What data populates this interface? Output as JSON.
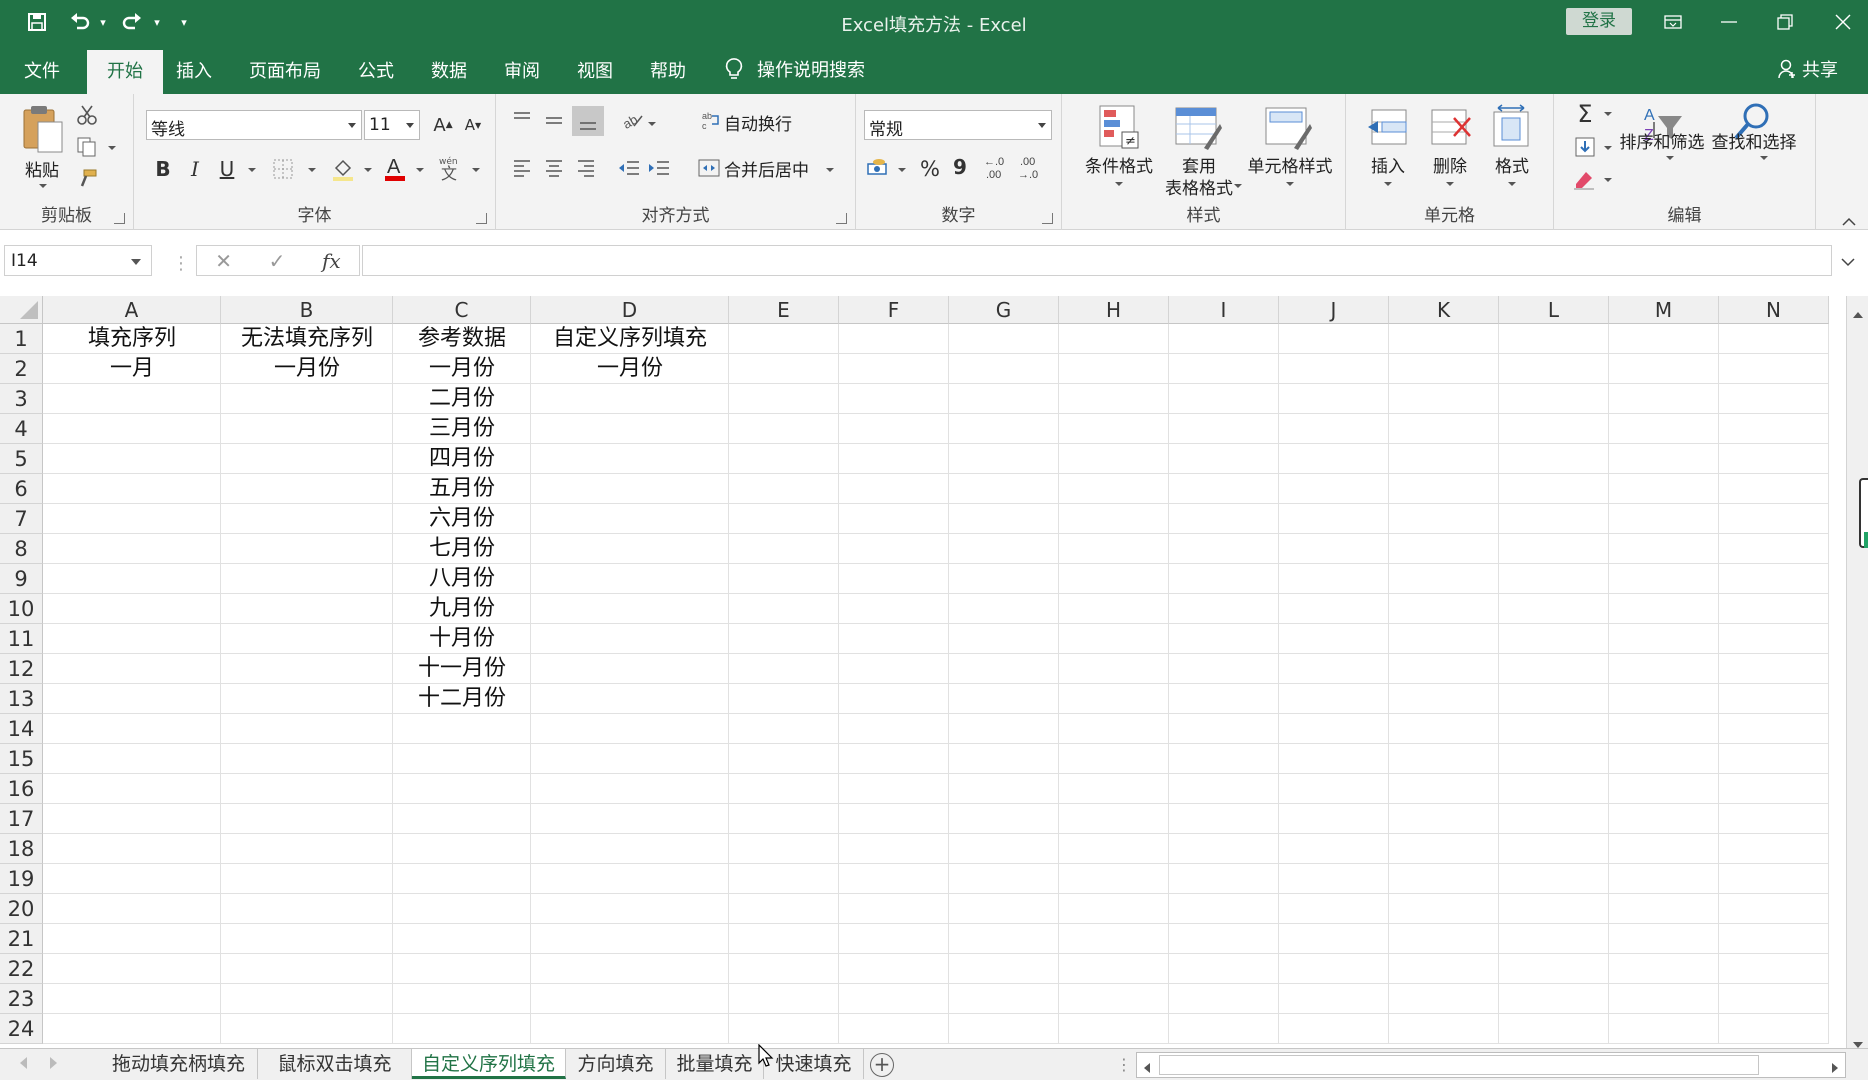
{
  "window": {
    "title": "Excel填充方法  -  Excel",
    "login": "登录"
  },
  "menu": {
    "tabs": [
      "文件",
      "开始",
      "插入",
      "页面布局",
      "公式",
      "数据",
      "审阅",
      "视图",
      "帮助"
    ],
    "active": "开始",
    "search": "操作说明搜索",
    "share": "共享"
  },
  "ribbon": {
    "clipboard": {
      "label": "剪贴板",
      "paste": "粘贴"
    },
    "font": {
      "label": "字体",
      "name": "等线",
      "size": "11",
      "grow": "A",
      "shrink": "A",
      "bold": "B",
      "italic": "I",
      "underline": "U",
      "phonetic": "wén"
    },
    "alignment": {
      "label": "对齐方式",
      "wrap": "自动换行",
      "merge": "合并后居中"
    },
    "number": {
      "label": "数字",
      "format": "常规",
      "percent": "%",
      "comma": "9",
      "inc_decimal": "←.0 .00",
      "dec_decimal": ".00 →.0"
    },
    "styles": {
      "label": "样式",
      "conditional": "条件格式",
      "table_line1": "套用",
      "table_line2": "表格格式",
      "cell_styles": "单元格样式"
    },
    "cells": {
      "label": "单元格",
      "insert": "插入",
      "delete": "删除",
      "format": "格式"
    },
    "editing": {
      "label": "编辑",
      "sum": "Σ",
      "sort": "排序和筛选",
      "find": "查找和选择"
    }
  },
  "formula_bar": {
    "name_box": "I14",
    "cancel": "✕",
    "enter": "✓",
    "fx": "fx",
    "value": ""
  },
  "grid": {
    "columns": [
      "A",
      "B",
      "C",
      "D",
      "E",
      "F",
      "G",
      "H",
      "I",
      "J",
      "K",
      "L",
      "M",
      "N"
    ],
    "rows": [
      "1",
      "2",
      "3",
      "4",
      "5",
      "6",
      "7",
      "8",
      "9",
      "10",
      "11",
      "12",
      "13",
      "14",
      "15",
      "16",
      "17",
      "18",
      "19",
      "20",
      "21",
      "22",
      "23",
      "24"
    ],
    "cells": {
      "A1": "填充序列",
      "B1": "无法填充序列",
      "C1": "参考数据",
      "D1": "自定义序列填充",
      "A2": "一月",
      "B2": "一月份",
      "C2": "一月份",
      "D2": "一月份",
      "C3": "二月份",
      "C4": "三月份",
      "C5": "四月份",
      "C6": "五月份",
      "C7": "六月份",
      "C8": "七月份",
      "C9": "八月份",
      "C10": "九月份",
      "C11": "十月份",
      "C12": "十一月份",
      "C13": "十二月份"
    }
  },
  "sheets": {
    "tabs": [
      "拖动填充柄填充",
      "鼠标双击填充",
      "自定义序列填充",
      "方向填充",
      "批量填充",
      "快速填充"
    ],
    "active": "自定义序列填充",
    "add": "+"
  },
  "colors": {
    "accent": "#217346",
    "ribbon_bg": "#f3f3f3"
  }
}
